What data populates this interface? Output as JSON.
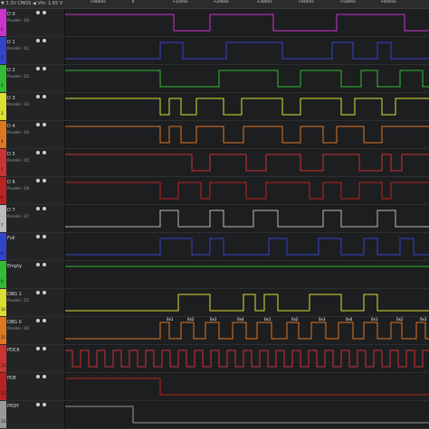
{
  "header": {
    "voltage_label": "▼ 3.3V CMOS ◀ Vth: 1.65 V",
    "time_labels": [
      "+900ns",
      "0",
      "+100ns",
      "+200ns",
      "+300ns",
      "+400ns",
      "+500ns",
      "+600ns"
    ],
    "ruler_labels": [
      "D1",
      "0A",
      "07",
      "0A",
      "05",
      "02",
      "7C",
      "C5",
      "05",
      "0A",
      "06",
      "02",
      "7C",
      "C5",
      "05",
      "07",
      "0A",
      "02",
      "5C"
    ]
  },
  "channels": [
    {
      "name": "D 0",
      "sub": "Parallel - D0",
      "color": "#cc33cc",
      "num": "0",
      "wave": "pattern0"
    },
    {
      "name": "D 1",
      "sub": "Parallel - D1",
      "color": "#3344cc",
      "num": "1",
      "wave": "pattern1"
    },
    {
      "name": "D 2",
      "sub": "Parallel - D2",
      "color": "#33bb33",
      "num": "2",
      "wave": "pattern2"
    },
    {
      "name": "D 3",
      "sub": "Parallel - D3",
      "color": "#dddd33",
      "num": "3",
      "wave": "pattern3"
    },
    {
      "name": "D 4",
      "sub": "Parallel - D4",
      "color": "#dd7722",
      "num": "4",
      "wave": "pattern4"
    },
    {
      "name": "D 5",
      "sub": "Parallel - D5",
      "color": "#cc3333",
      "num": "5",
      "wave": "pattern5"
    },
    {
      "name": "D 6",
      "sub": "Parallel - D6",
      "color": "#bb2222",
      "num": "6",
      "wave": "pattern6"
    },
    {
      "name": "D 7",
      "sub": "Parallel - D7",
      "color": "#bbbbbb",
      "num": "7",
      "wave": "pattern7"
    },
    {
      "name": "Full",
      "sub": "",
      "color": "#3344cc",
      "num": "8",
      "wave": "pattern8"
    },
    {
      "name": "Empty",
      "sub": "",
      "color": "#33bb33",
      "num": "9",
      "wave": "pattern9"
    },
    {
      "name": "DBG 1",
      "sub": "Parallel - D1",
      "color": "#dddd33",
      "num": "10",
      "wave": "pattern10"
    },
    {
      "name": "DBG 0",
      "sub": "Parallel - D0",
      "color": "#dd7722",
      "num": "11",
      "wave": "pattern11"
    },
    {
      "name": "PDCK",
      "sub": "",
      "color": "#cc3333",
      "num": "12",
      "wave": "clock"
    },
    {
      "name": "PDE",
      "sub": "",
      "color": "#bb2222",
      "num": "13",
      "wave": "pde"
    },
    {
      "name": "PRDY",
      "sub": "",
      "color": "#999999",
      "num": "14",
      "wave": "prdy"
    }
  ],
  "decode_labels": [
    "0x1",
    "0x2",
    "0x3",
    "0x4",
    "0x1",
    "0x2",
    "0x3",
    "0x4",
    "0x1",
    "0x2",
    "0x3",
    "0x4"
  ]
}
